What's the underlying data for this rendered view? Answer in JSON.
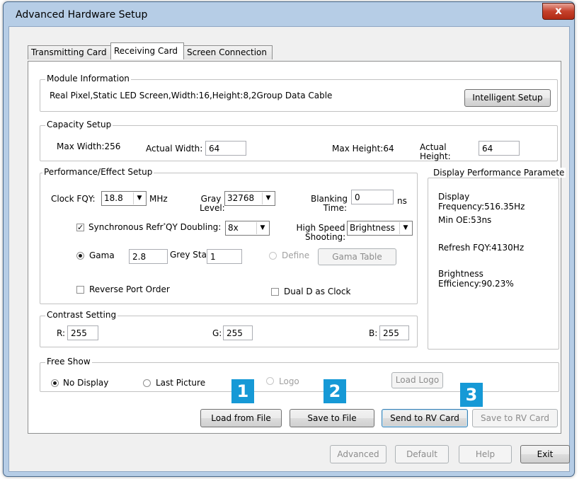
{
  "window": {
    "title": "Advanced Hardware Setup",
    "close_glyph": "x"
  },
  "tabs": [
    {
      "label": "Transmitting Card"
    },
    {
      "label": "Receiving Card"
    },
    {
      "label": "Screen Connection"
    }
  ],
  "module": {
    "legend": "Module Information",
    "description": "Real Pixel,Static LED Screen,Width:16,Height:8,2Group Data Cable",
    "intelligent_setup": "Intelligent Setup"
  },
  "capacity": {
    "legend": "Capacity Setup",
    "max_width": "Max Width:256",
    "actual_width_label": "Actual Width:",
    "actual_width_value": "64",
    "max_height": "Max Height:64",
    "actual_height_label_1": "Actual",
    "actual_height_label_2": "Height:",
    "actual_height_value": "64"
  },
  "performance": {
    "legend": "Performance/Effect Setup",
    "clock_label": "Clock FQY:",
    "clock_value": "18.8",
    "clock_unit": "MHz",
    "gray_label_1": "Gray",
    "gray_label_2": "Level:",
    "gray_value": "32768",
    "blanking_label_1": "Blanking",
    "blanking_label_2": "Time:",
    "blanking_value": "0",
    "blanking_unit": "ns",
    "sync_label": "Synchronous Refr",
    "sync_label_2": "QY Doubling:",
    "sync_checked": true,
    "sync_value": "8x",
    "high_speed_label_1": "High Speed",
    "high_speed_label_2": "Shooting:",
    "high_speed_value": "Brightness",
    "gama_label": "Gama",
    "gama_value": "2.8",
    "grey_start_label": "Grey Start:",
    "grey_start_value": "1",
    "define_label": "Define",
    "gama_table_button": "Gama Table",
    "reverse_port_label": "Reverse Port Order",
    "dual_d_label": "Dual D as Clock"
  },
  "display_params": {
    "legend": "Display Performance Paramete",
    "freq_line_1": "Display",
    "freq_line_2": "Frequency:516.35Hz",
    "min_oe": "Min OE:53ns",
    "refresh": "Refresh FQY:4130Hz",
    "brightness_line_1": "Brightness",
    "brightness_line_2": "Efficiency:90.23%"
  },
  "contrast": {
    "legend": "Contrast Setting",
    "r_label": "R:",
    "r_value": "255",
    "g_label": "G:",
    "g_value": "255",
    "b_label": "B:",
    "b_value": "255"
  },
  "free_show": {
    "legend": "Free Show",
    "no_display": "No Display",
    "last_picture": "Last Picture",
    "logo": "Logo",
    "load_logo": "Load Logo",
    "selected": "No Display"
  },
  "actions": {
    "load_from_file": "Load from File",
    "save_to_file": "Save to File",
    "send_to_rv_card": "Send to RV Card",
    "save_to_rv_card": "Save to RV Card"
  },
  "footer": {
    "advanced": "Advanced",
    "default": "Default",
    "help": "Help",
    "exit": "Exit"
  },
  "callouts": [
    "1",
    "2",
    "3"
  ],
  "colors": {
    "callout": "#1699d6",
    "close": "#c5412b",
    "frame": "#b6cde6"
  }
}
